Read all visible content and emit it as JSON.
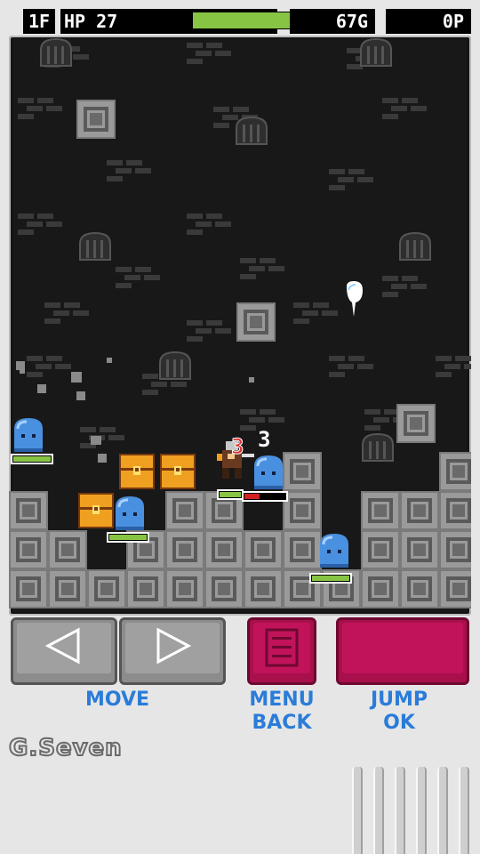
{
  "hud": {
    "floor": "1F",
    "hp_label": "HP",
    "hp_value": "27",
    "hp_fraction": 0.88,
    "gold": "67G",
    "points": "0P"
  },
  "battle": {
    "damage_red": "3",
    "damage_white": "3",
    "player_hp_fraction": 0.4,
    "enemy_hp_fraction": 1.0
  },
  "controls": {
    "move_label": "MOVE",
    "menu_label": "MENU",
    "back_label": "BACK",
    "jump_label": "JUMP",
    "ok_label": "OK"
  },
  "logo": "G.Seven",
  "colors": {
    "hp_fill": "#88c444",
    "label_blue": "#2a7cd8",
    "magenta": "#c0135a",
    "slime_blue": "#4a90e0",
    "chest_orange": "#f0a020"
  }
}
